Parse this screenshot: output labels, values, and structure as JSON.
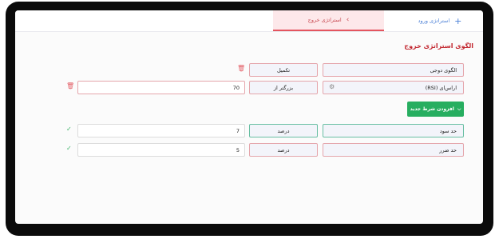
{
  "tabs": {
    "entry_label": "استراتژی ورود",
    "exit_label": "استراتژی خروج"
  },
  "section": {
    "title": "الگوی استراتژی خروج"
  },
  "row1": {
    "pattern": "الگوی دوجی",
    "completion": "تکمیل"
  },
  "row2": {
    "indicator": "اراس‌ای (RSI)",
    "operator": "بزرگتر از",
    "value": "70"
  },
  "add_condition": {
    "label": "افزودن شرط جدید"
  },
  "take_profit": {
    "label": "حد سود",
    "unit": "درصد",
    "value": "7"
  },
  "stop_loss": {
    "label": "حد ضرر",
    "unit": "درصد",
    "value": "5"
  },
  "colors": {
    "accent_red": "#c2262f",
    "accent_green": "#27ae60",
    "tab_blue": "#4a7fd6"
  }
}
